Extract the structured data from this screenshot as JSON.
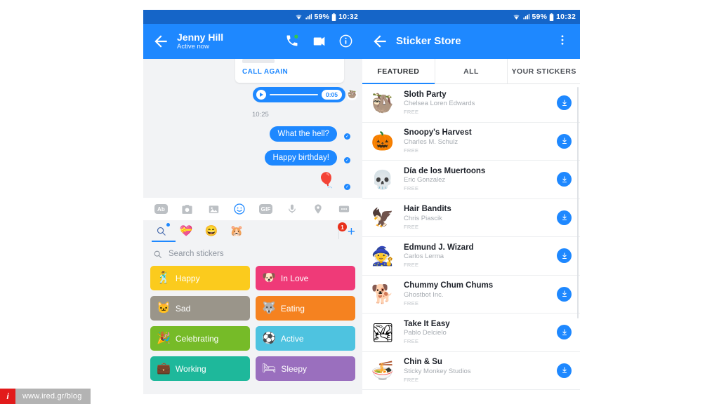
{
  "statusbar": {
    "battery": "59%",
    "time": "10:32",
    "wifi_icon": "wifi-icon",
    "signal_icon": "signal-icon",
    "battery_icon": "battery-icon"
  },
  "left_panel": {
    "appbar": {
      "back_icon": "back-arrow-icon",
      "contact_name": "Jenny Hill",
      "presence": "Active now",
      "call_icon": "phone-call-icon",
      "video_icon": "video-camera-icon",
      "info_icon": "info-circle-icon"
    },
    "conversation": {
      "call_card_action": "CALL AGAIN",
      "audio_duration": "0:05",
      "timestamp": "10:25",
      "messages": [
        {
          "text": "What the hell?"
        },
        {
          "text": "Happy birthday!"
        }
      ],
      "sticker_emoji": "🎈",
      "seen_marker": "✓"
    },
    "composer_icons": [
      {
        "name": "text-format-icon",
        "glyph": "Ab"
      },
      {
        "name": "camera-icon",
        "glyph": "📷"
      },
      {
        "name": "photo-gallery-icon",
        "glyph": "🖼"
      },
      {
        "name": "emoji-sticker-icon",
        "glyph": "☺"
      },
      {
        "name": "gif-icon",
        "glyph": "GIF"
      },
      {
        "name": "microphone-icon",
        "glyph": "🎤"
      },
      {
        "name": "location-pin-icon",
        "glyph": "📍"
      },
      {
        "name": "more-options-icon",
        "glyph": "•••"
      }
    ],
    "sticker_tray": {
      "tabs": [
        {
          "name": "sticker-search-tab",
          "glyph": "🔍"
        },
        {
          "name": "sticker-pack-heart-tab",
          "glyph": "💝"
        },
        {
          "name": "sticker-pack-smiley-tab",
          "glyph": "😄"
        },
        {
          "name": "sticker-pack-pusheen-tab",
          "glyph": "🐹"
        }
      ],
      "badge_count": "1",
      "add_label": "+"
    },
    "sticker_search": {
      "placeholder": "Search stickers",
      "search_icon": "search-icon"
    },
    "categories": [
      {
        "label": "Happy",
        "color": "#fbcb1d",
        "emoji": "🕺"
      },
      {
        "label": "In Love",
        "color": "#ef3a78",
        "emoji": "🐶"
      },
      {
        "label": "Sad",
        "color": "#9a958a",
        "emoji": "🐱"
      },
      {
        "label": "Eating",
        "color": "#f58220",
        "emoji": "🐺"
      },
      {
        "label": "Celebrating",
        "color": "#76bb28",
        "emoji": "🎉"
      },
      {
        "label": "Active",
        "color": "#4ec3e0",
        "emoji": "⚽"
      },
      {
        "label": "Working",
        "color": "#1eb89b",
        "emoji": "💼"
      },
      {
        "label": "Sleepy",
        "color": "#9a6fbe",
        "emoji": "🛏"
      }
    ]
  },
  "right_panel": {
    "appbar": {
      "back_icon": "back-arrow-icon",
      "title": "Sticker Store",
      "overflow_icon": "overflow-menu-icon"
    },
    "tabs": [
      {
        "label": "FEATURED",
        "active": true
      },
      {
        "label": "ALL",
        "active": false
      },
      {
        "label": "YOUR STICKERS",
        "active": false
      }
    ],
    "packs": [
      {
        "name": "Sloth Party",
        "author": "Chelsea Loren Edwards",
        "price": "FREE",
        "emoji": "🦥"
      },
      {
        "name": "Snoopy's Harvest",
        "author": "Charles M. Schulz",
        "price": "FREE",
        "emoji": "🎃"
      },
      {
        "name": "Día de los Muertoons",
        "author": "Eric Gonzalez",
        "price": "FREE",
        "emoji": "💀"
      },
      {
        "name": "Hair Bandits",
        "author": "Chris Piascik",
        "price": "FREE",
        "emoji": "🦅"
      },
      {
        "name": "Edmund J. Wizard",
        "author": "Carlos Lerma",
        "price": "FREE",
        "emoji": "🧙"
      },
      {
        "name": "Chummy Chum Chums",
        "author": "Ghostbot Inc.",
        "price": "FREE",
        "emoji": "🐕"
      },
      {
        "name": "Take It Easy",
        "author": "Pablo Delcielo",
        "price": "FREE",
        "emoji": "🏞"
      },
      {
        "name": "Chin & Su",
        "author": "Sticky Monkey Studios",
        "price": "FREE",
        "emoji": "🍜"
      }
    ],
    "download_icon": "download-arrow-icon"
  },
  "watermark": {
    "badge": "i",
    "url": "www.ired.gr/blog"
  },
  "colors": {
    "accent": "#1e88ff",
    "statusbar": "#1565c8",
    "badge_red": "#e8301b",
    "chat_bg": "#f2f3f5"
  }
}
